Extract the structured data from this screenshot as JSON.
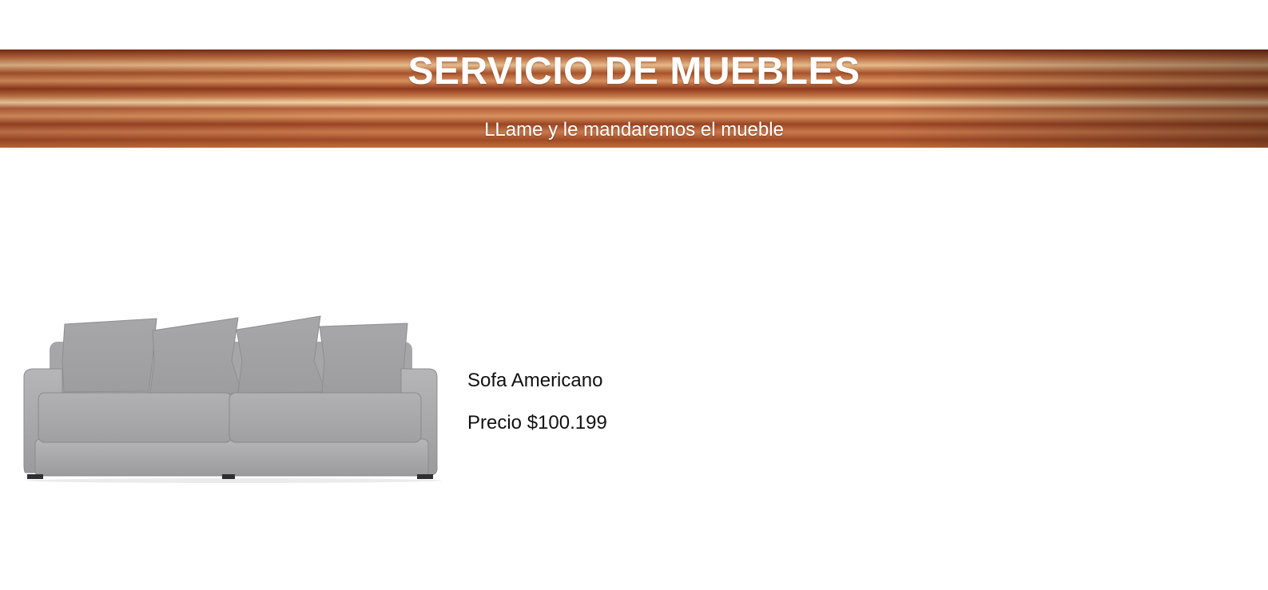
{
  "header": {
    "title": "SERVICIO DE MUEBLES",
    "subtitle": "LLame y le mandaremos el mueble"
  },
  "product": {
    "name": "Sofa Americano",
    "price": "Precio $100.199",
    "image_icon": "sofa-image"
  },
  "colors": {
    "background": "#ffffff",
    "banner_text": "#ffffff",
    "text": "#111111",
    "sofa_fabric": "#a9a9ab"
  }
}
